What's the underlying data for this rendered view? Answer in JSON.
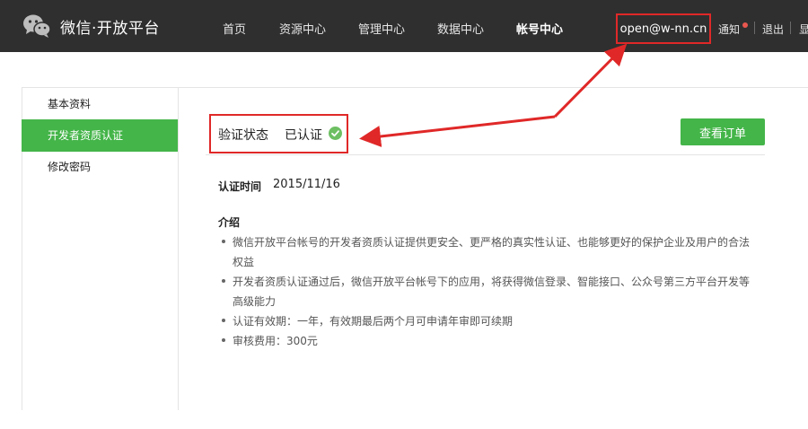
{
  "header": {
    "brand": "微信·开放平台",
    "nav": [
      "首页",
      "资源中心",
      "管理中心",
      "数据中心",
      "帐号中心"
    ],
    "account": "open@w-nn.cn",
    "notice": "通知",
    "logout": "退出",
    "extra": "显"
  },
  "sidebar": {
    "items": [
      "基本资料",
      "开发者资质认证",
      "修改密码"
    ],
    "active": "开发者资质认证"
  },
  "main": {
    "status_label": "验证状态",
    "status_value": "已认证",
    "orders_button": "查看订单",
    "cert_time_label": "认证时间",
    "cert_time_value": "2015/11/16",
    "intro_title": "介绍",
    "intro_lines": [
      "微信开放平台帐号的开发者资质认证提供更安全、更严格的真实性认证、也能够更好的保护企业及用户的合法",
      "权益",
      "开发者资质认证通过后，微信开放平台帐号下的应用，将获得微信登录、智能接口、公众号第三方平台开发等",
      "高级能力",
      "认证有效期：一年，有效期最后两个月可申请年审即可续期",
      "审核费用：300元"
    ]
  },
  "colors": {
    "header_bg": "#2f2f2f",
    "accent_green": "#44b549",
    "highlight_red": "#e02828"
  },
  "icons": {
    "logo": "wechat-logo-icon",
    "status": "check-circle-icon"
  }
}
